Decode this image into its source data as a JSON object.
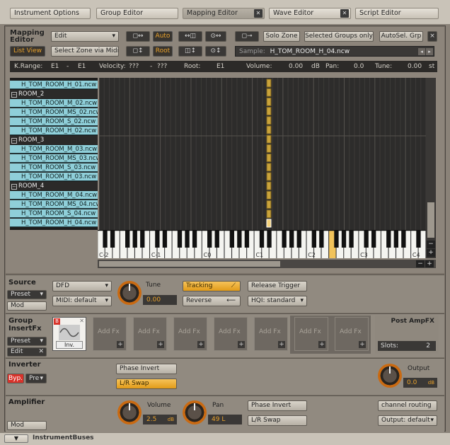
{
  "tabs": [
    {
      "label": "Instrument Options",
      "active": false,
      "close": false
    },
    {
      "label": "Group Editor",
      "active": false,
      "close": false
    },
    {
      "label": "Mapping Editor",
      "active": true,
      "close": true
    },
    {
      "label": "Wave Editor",
      "active": false,
      "close": true
    },
    {
      "label": "Script Editor",
      "active": false,
      "close": false
    }
  ],
  "mapping_editor": {
    "title": "Mapping Editor",
    "edit_dropdown": "Edit",
    "list_view": "List View",
    "select_zone_midi": "Select Zone via Midi",
    "auto": "Auto",
    "root": "Root",
    "solo_zone": "Solo Zone",
    "selected_groups_only": "Selected Groups only",
    "autosel_grp": "AutoSel. Grp",
    "close": "×",
    "sample_label": "Sample:",
    "sample_value": "H_TOM_ROOM_H_04.ncw"
  },
  "infobar": {
    "krange_label": "K.Range:",
    "krange_lo": "E1",
    "krange_dash": "-",
    "krange_hi": "E1",
    "velocity_label": "Velocity:",
    "vel_lo": "???",
    "vel_dash": "-",
    "vel_hi": "???",
    "root_label": "Root:",
    "root_value": "E1",
    "volume_label": "Volume:",
    "volume_value": "0.00",
    "volume_unit": "dB",
    "pan_label": "Pan:",
    "pan_value": "0.0",
    "tune_label": "Tune:",
    "tune_value": "0.00",
    "tune_unit": "st"
  },
  "zones": [
    {
      "type": "zone",
      "label": "H_TOM_ROOM_H_01.ncw"
    },
    {
      "type": "group",
      "label": "ROOM_2"
    },
    {
      "type": "zone",
      "label": "H_TOM_ROOM_M_02.ncw"
    },
    {
      "type": "zone",
      "label": "H_TOM_ROOM_MS_02.ncw"
    },
    {
      "type": "zone",
      "label": "H_TOM_ROOM_S_02.ncw"
    },
    {
      "type": "zone",
      "label": "H_TOM_ROOM_H_02.ncw"
    },
    {
      "type": "group",
      "label": "ROOM_3"
    },
    {
      "type": "zone",
      "label": "H_TOM_ROOM_M_03.ncw"
    },
    {
      "type": "zone",
      "label": "H_TOM_ROOM_MS_03.ncw"
    },
    {
      "type": "zone",
      "label": "H_TOM_ROOM_S_03.ncw"
    },
    {
      "type": "zone",
      "label": "H_TOM_ROOM_H_03.ncw"
    },
    {
      "type": "group",
      "label": "ROOM_4"
    },
    {
      "type": "zone",
      "label": "H_TOM_ROOM_M_04.ncw"
    },
    {
      "type": "zone",
      "label": "H_TOM_ROOM_MS_04.ncw"
    },
    {
      "type": "zone",
      "label": "H_TOM_ROOM_S_04.ncw"
    },
    {
      "type": "zone",
      "label": "H_TOM_ROOM_H_04.ncw"
    }
  ],
  "keyboard": {
    "octave_labels": [
      "C-2",
      "C-1",
      "C0",
      "C1",
      "C2",
      "C3",
      "C4"
    ],
    "highlighted_key": "E1",
    "plus": "+",
    "minus": "−"
  },
  "source": {
    "title": "Source",
    "preset": "Preset",
    "mod": "Mod",
    "mode": "DFD",
    "midi": "MIDI: default",
    "tune_label": "Tune",
    "tune_value": "0.00",
    "tracking": "Tracking",
    "reverse": "Reverse",
    "release_trigger": "Release Trigger",
    "hq": "HQI: standard"
  },
  "group_fx": {
    "title": "Group InsertFx",
    "preset": "Preset",
    "edit": "Edit",
    "inv_label": "Inv.",
    "slot_label": "Add Fx",
    "post_title": "Post AmpFX",
    "slots_label": "Slots:",
    "slots_value": "2"
  },
  "inverter": {
    "title": "Inverter",
    "byp": "Byp.",
    "pre": "Pre",
    "phase_invert": "Phase Invert",
    "lr_swap": "L/R Swap",
    "output_label": "Output",
    "output_value": "0.0",
    "output_unit": "dB"
  },
  "amplifier": {
    "title": "Amplifier",
    "mod": "Mod",
    "volume_label": "Volume",
    "volume_value": "2.5",
    "volume_unit": "dB",
    "pan_label": "Pan",
    "pan_value": "49 L",
    "phase_invert": "Phase Invert",
    "lr_swap": "L/R Swap",
    "channel_routing": "channel routing",
    "output": "Output: default"
  },
  "bottom": {
    "instrument_buses": "InstrumentBuses"
  },
  "colors": {
    "accent": "#e8a12b",
    "zone": "#8fcfd9",
    "bypass": "#d8322a"
  }
}
